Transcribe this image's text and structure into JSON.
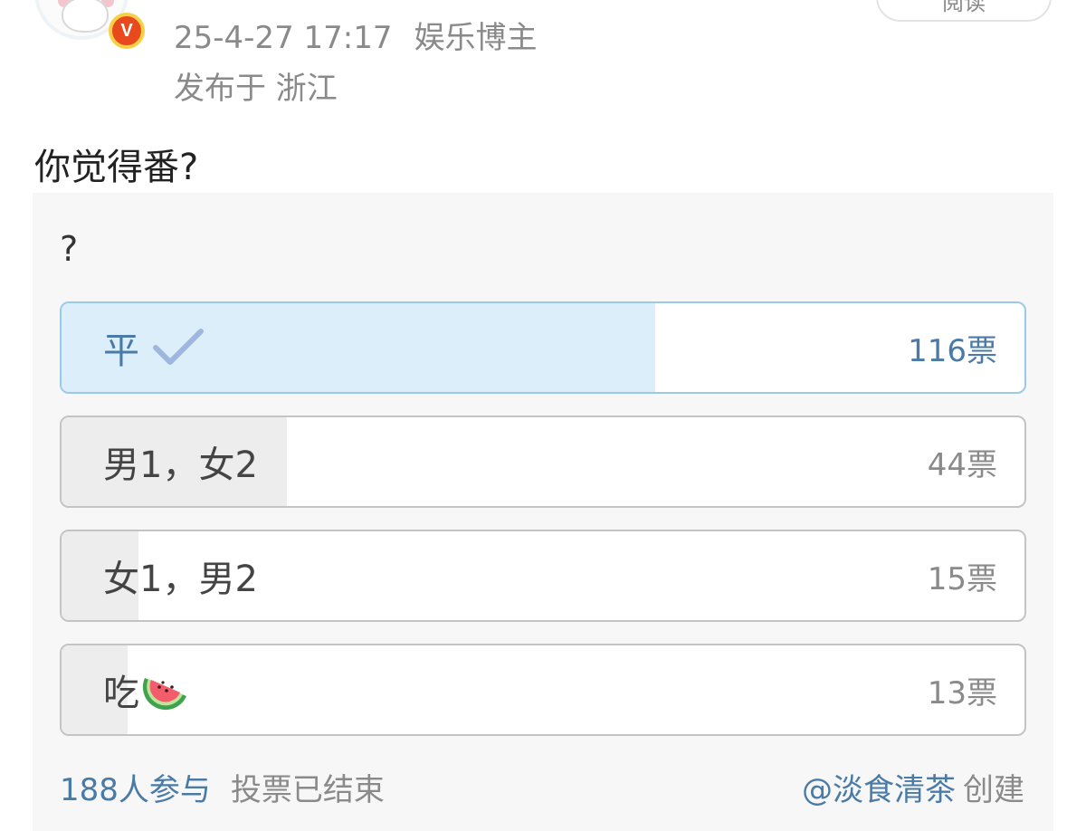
{
  "post": {
    "datetime": "25-4-27 17:17",
    "role": "娱乐博主",
    "location": "发布于 浙江",
    "read_button": "阅读",
    "text": "你觉得番?"
  },
  "poll": {
    "question": "?",
    "options": [
      {
        "label": "平",
        "votes": "116票",
        "vote_count": 116,
        "share": 0.617,
        "selected": true
      },
      {
        "label": "男1，女2",
        "votes": "44票",
        "vote_count": 44,
        "share": 0.234,
        "selected": false
      },
      {
        "label": "女1，男2",
        "votes": "15票",
        "vote_count": 15,
        "share": 0.08,
        "selected": false
      },
      {
        "label": "吃",
        "votes": "13票",
        "vote_count": 13,
        "share": 0.069,
        "selected": false
      }
    ],
    "participants": "188人参与",
    "status": "投票已结束",
    "creator": "@淡食清茶",
    "creator_suffix": "创建"
  },
  "colors": {
    "accent": "#4a7ba7",
    "selected_fill": "#ddeefb",
    "selected_border": "#9cc8ea",
    "unselected_fill": "#ededed",
    "badge_red": "#e8491d",
    "badge_gold": "#f7d046"
  },
  "icons": [
    "verified-v-badge-icon",
    "checkmark-icon",
    "watermelon-emoji-icon"
  ]
}
